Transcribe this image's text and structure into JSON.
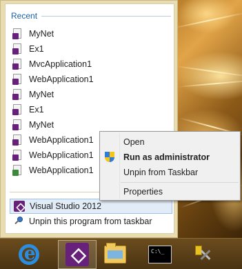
{
  "jumplist": {
    "section_title": "Recent",
    "recent_items": [
      {
        "label": "MyNet",
        "icon": "vs-solution-icon"
      },
      {
        "label": "Ex1",
        "icon": "vs-solution-icon"
      },
      {
        "label": "MvcApplication1",
        "icon": "vs-solution-icon"
      },
      {
        "label": "WebApplication1",
        "icon": "vs-solution-icon"
      },
      {
        "label": "MyNet",
        "icon": "vs-solution-icon"
      },
      {
        "label": "Ex1",
        "icon": "vs-solution-icon"
      },
      {
        "label": "MyNet",
        "icon": "vs-solution-icon"
      },
      {
        "label": "WebApplication1",
        "icon": "vs-solution-icon"
      },
      {
        "label": "WebApplication1",
        "icon": "vs-solution-icon"
      },
      {
        "label": "WebApplication1",
        "icon": "csharp-project-icon"
      }
    ],
    "program_label": "Visual Studio 2012",
    "unpin_label": "Unpin this program from taskbar"
  },
  "context_menu": {
    "items": [
      {
        "label": "Open",
        "bold": false
      },
      {
        "label": "Run as administrator",
        "bold": true,
        "icon": "uac-shield-icon"
      },
      {
        "label": "Unpin from Taskbar",
        "bold": false
      },
      {
        "label": "Properties",
        "bold": false
      }
    ]
  },
  "taskbar": {
    "buttons": [
      {
        "name": "internet-explorer",
        "icon": "ie-icon"
      },
      {
        "name": "visual-studio",
        "icon": "visual-studio-icon",
        "active": true
      },
      {
        "name": "file-explorer",
        "icon": "folder-icon"
      },
      {
        "name": "command-prompt",
        "icon": "cmd-icon",
        "text": "C:\\_"
      },
      {
        "name": "tools",
        "icon": "tools-icon"
      }
    ]
  },
  "colors": {
    "accent": "#68217a",
    "header_blue": "#1a5fa8",
    "highlight": "#e2ecf7"
  }
}
